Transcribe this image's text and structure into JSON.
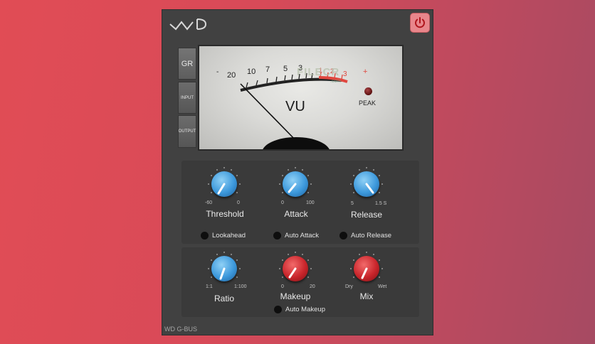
{
  "app": {
    "footer_name": "WD G-BUS",
    "logo_icon": "wd-logo-icon",
    "power_icon": "power-icon",
    "accent_colors": {
      "power": "#e8868b",
      "blue_knob": "#3d99dc",
      "red_knob": "#c9252b"
    }
  },
  "modes": {
    "gr": "GR",
    "input": "INPUT",
    "output": "OUTPUT"
  },
  "meter": {
    "label": "VU",
    "peak_label": "PEAK",
    "scale_labels": [
      "-",
      "20",
      "10",
      "7",
      "5",
      "3",
      "1",
      "2",
      "3"
    ],
    "plus_label": "+",
    "watermark": "FILECR",
    "watermark_sub": ".com"
  },
  "controls": {
    "threshold": {
      "label": "Threshold",
      "min": "-60",
      "max": "0"
    },
    "attack": {
      "label": "Attack",
      "min": "0",
      "max": "100"
    },
    "release": {
      "label": "Release",
      "min": "5",
      "max": "1.5 S"
    },
    "ratio": {
      "label": "Ratio",
      "min": "1:1",
      "max": "1:100"
    },
    "makeup": {
      "label": "Makeup",
      "min": "0",
      "max": "20"
    },
    "mix": {
      "label": "Mix",
      "min": "Dry",
      "max": "Wet"
    }
  },
  "toggles": {
    "lookahead": "Lookahead",
    "auto_attack": "Auto Attack",
    "auto_release": "Auto Release",
    "auto_makeup": "Auto Makeup"
  }
}
